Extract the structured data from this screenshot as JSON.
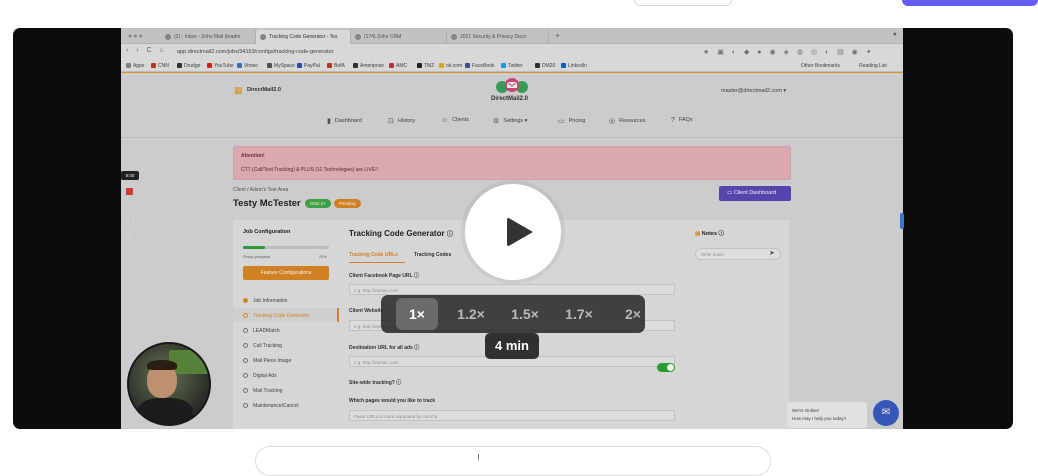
{
  "speed_options": [
    {
      "label": "1×",
      "active": true
    },
    {
      "label": "1.2×",
      "active": false
    },
    {
      "label": "1.5×",
      "active": false
    },
    {
      "label": "1.7×",
      "active": false
    },
    {
      "label": "2×",
      "active": false
    }
  ],
  "duration_label": "4 min",
  "recorder": {
    "time": "6:00"
  },
  "browser": {
    "tabs": [
      "(2) - Inbox - Zoho Mail (bradm",
      "Tracking Code Generator - Tes",
      "(174) Zoho CRM",
      "2021 Security & Privacy Deco"
    ],
    "active_tab": 1,
    "url": "app.directmail2.com/jobs/34153/configs/tracking-code-generator",
    "bookmarks": [
      "Apps",
      "CNN",
      "Drudge",
      "YouTube",
      "Vimeo",
      "MySpace",
      "PayPal",
      "BofA",
      "Ameriprise",
      "AMC",
      "TMZ",
      "ok.com",
      "FaceBook",
      "Twitter",
      "DM20",
      "LinkedIn"
    ],
    "bookmarks_right": [
      "Other Bookmarks",
      "Reading List"
    ]
  },
  "site": {
    "brand": "DirectMail2.0",
    "logo_text": "DirectMail2.0",
    "user_email": "master@directmail2.com ▾",
    "nav": [
      {
        "icon": "chart-icon",
        "glyph": "▮",
        "label": "Dashboard"
      },
      {
        "icon": "history-icon",
        "glyph": "⊡",
        "label": "History"
      },
      {
        "icon": "clients-icon",
        "glyph": "☺",
        "label": "Clients"
      },
      {
        "icon": "settings-icon",
        "glyph": "⚙",
        "label": "Settings ▾"
      },
      {
        "icon": "pricing-icon",
        "glyph": "▭",
        "label": "Pricing"
      },
      {
        "icon": "resources-icon",
        "glyph": "◎",
        "label": "Resources"
      },
      {
        "icon": "faq-icon",
        "glyph": "?",
        "label": "FAQs"
      }
    ],
    "alert": {
      "title": "Attention!",
      "text": "CTT (Call/Text Tracking) & PLUS (11 Technologies) are LIVE!!"
    },
    "breadcrumb": "Client  /  Adam's Test Area",
    "client_name": "Testy McTester",
    "badges": [
      {
        "label": "DM2.0+",
        "color": "#45a84a"
      },
      {
        "label": "Pending",
        "color": "#dd8a26"
      }
    ],
    "client_dashboard_button": "Client Dashboard",
    "job_config": {
      "title": "Job Configuration",
      "progress_label": "Setup progress",
      "progress_value": "25%",
      "progress_fraction": 0.25,
      "feature_button": "Feature Configurations",
      "items": [
        {
          "label": "Job Information",
          "state": "done"
        },
        {
          "label": "Tracking Code Generator",
          "state": "active"
        },
        {
          "label": "LEADMatch",
          "state": "todo"
        },
        {
          "label": "Call Tracking",
          "state": "todo"
        },
        {
          "label": "Mail Piece Image",
          "state": "todo"
        },
        {
          "label": "Digital Ads",
          "state": "todo"
        },
        {
          "label": "Mail Tracking",
          "state": "todo"
        },
        {
          "label": "Maintenance/Cancel",
          "state": "todo"
        }
      ]
    },
    "tcg": {
      "title": "Tracking Code Generator",
      "tabs": [
        "Tracking Code URLs",
        "Tracking Codes"
      ],
      "fields": [
        {
          "label": "Client Facebook Page URL",
          "placeholder": "e.g. http://domain.com"
        },
        {
          "label": "Client Website",
          "placeholder": "e.g. http://domain.com"
        },
        {
          "label": "Destination URL for all ads",
          "placeholder": "e.g. http://domain.com"
        }
      ],
      "sitewide_label": "Site-wide tracking?",
      "pages_label": "Which pages would you like to track",
      "pages_placeholder": "Paste URLs to track separated by comma"
    },
    "notes": {
      "title": "Notes",
      "placeholder": "Write notes"
    },
    "chat": {
      "line1": "We're Online!",
      "line2": "How may I help you today?"
    }
  },
  "colors": {
    "accent": "#dd8a26",
    "brand_purple": "#5b4ab8",
    "top_button": "#625df5",
    "success": "#2aa53a"
  }
}
